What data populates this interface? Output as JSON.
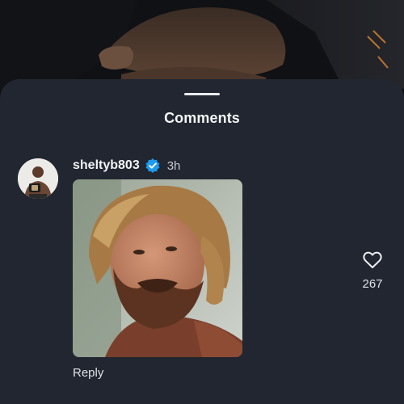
{
  "background": {
    "description_icon": "video-frame-hands"
  },
  "sheet": {
    "title": "Comments"
  },
  "comment": {
    "username": "sheltyb803",
    "timestamp": "3h",
    "verified_icon": "verified-badge-icon",
    "reply_label": "Reply",
    "like_count": "267",
    "like_icon": "heart-outline-icon"
  },
  "colors": {
    "sheet_background": "#212630",
    "verified_blue": "#1d9bf0",
    "text_primary": "#f3f4f6",
    "text_secondary": "#c6cad2"
  }
}
